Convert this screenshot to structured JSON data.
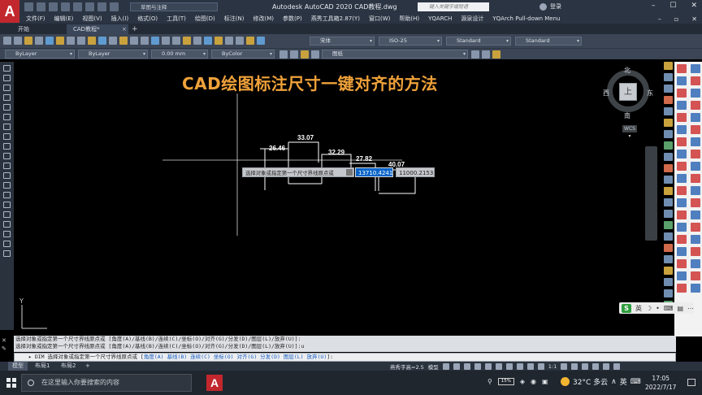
{
  "window": {
    "app_logo": "A",
    "workspace": "草图与注释",
    "title": "Autodesk AutoCAD 2020    CAD教程.dwg",
    "search_placeholder": "键入关键字或短语",
    "login_label": "登录",
    "controls": [
      "–",
      "☐",
      "✕"
    ]
  },
  "menubar": {
    "items": [
      "文件(F)",
      "编辑(E)",
      "视图(V)",
      "插入(I)",
      "格式(O)",
      "工具(T)",
      "绘图(D)",
      "标注(N)",
      "修改(M)",
      "参数(P)",
      "燕秀工具箱2.87(Y)",
      "窗口(W)",
      "帮助(H)",
      "YQARCH",
      "源泉设计",
      "YQArch Pull-down Menu"
    ],
    "right_controls": [
      "–",
      "▫",
      "✕"
    ]
  },
  "tabs": {
    "start": "开始",
    "active": "CAD教程*",
    "close": "×",
    "add": "+"
  },
  "toolbar": {
    "text_style": "宋体",
    "dim_style": "ISO-25",
    "table_style": "Standard",
    "multileader_style": "Standard",
    "layer_color": "ByLayer",
    "linetype": "ByLayer",
    "lineweight": "0.00 mm",
    "plot_style": "ByColor",
    "layer_name": "图纸"
  },
  "drawing": {
    "title": "CAD绘图标注尺寸一键对齐的方法",
    "dimensions": [
      "26.46",
      "33.07",
      "32.29",
      "27.82",
      "40.07"
    ],
    "tooltip": "选择对象或指定第一个尺寸界线原点或",
    "coord_x": "13710.4241",
    "coord_y": "11000.2153",
    "ucs_label": "Y"
  },
  "viewcube": {
    "face": "上",
    "north": "北",
    "south": "南",
    "east": "东",
    "west": "西",
    "wcs": "WCS ▾"
  },
  "ime": {
    "logo": "S",
    "lang": "英",
    "items": [
      "☽",
      "•",
      "⌨",
      "▤",
      "⋯"
    ]
  },
  "command": {
    "history": [
      "选择对象或指定第一个尺寸界线原点或 [角度(A)/基线(B)/连续(C)/坐标(O)/对齐(G)/分发(D)/图层(L)/放弃(U)]:",
      "选择对象或指定第一个尺寸界线原点或 [角度(A)/基线(B)/连续(C)/坐标(O)/对齐(G)/分发(D)/图层(L)/放弃(U)]:u"
    ],
    "input_prefix": "▸ DIM 选择对象或指定第一个尺寸界线原点或 [",
    "options": [
      "角度(A)",
      "基线(B)",
      "连续(C)",
      "坐标(O)",
      "对齐(G)",
      "分发(D)",
      "图层(L)",
      "放弃(U)"
    ],
    "input_suffix": "]:"
  },
  "statusbar": {
    "tabs": [
      "模型",
      "布局1",
      "布局2",
      "+"
    ],
    "text_height": "燕秀字高=2.5",
    "model_label": "模型",
    "scale": "1:1"
  },
  "taskbar": {
    "search_placeholder": "在这里输入你要搜索的内容",
    "battery": "15%",
    "weather": "32°C  多云",
    "lang": "英",
    "time": "17:05",
    "date": "2022/7/17"
  },
  "colors": {
    "title_orange": "#f0a23a",
    "coord_blue": "#0a64c8",
    "chrome_dark": "#2b3442",
    "autocad_red": "#c2272d"
  }
}
